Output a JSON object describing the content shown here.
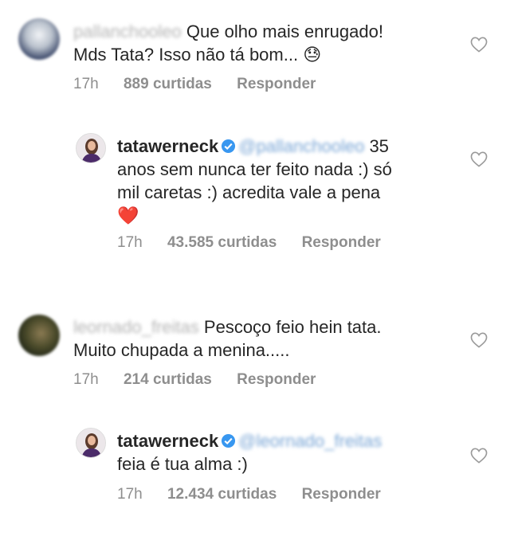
{
  "comments": [
    {
      "username": "pallanchooleo",
      "text": "Que olho mais enrugado! Mds Tata? Isso não tá bom...",
      "emoji": "😓",
      "time": "17h",
      "likes": "889 curtidas",
      "reply": "Responder",
      "replies": [
        {
          "username": "tatawerneck",
          "mention": "@pallanchooleo",
          "text_line1": "35",
          "text_line2": "anos sem nunca ter feito nada :) só",
          "text_line3": "mil caretas :) acredita vale a pena",
          "emoji": "❤️",
          "time": "17h",
          "likes": "43.585 curtidas",
          "reply": "Responder"
        }
      ]
    },
    {
      "username": "leornado_freitas",
      "text_line1": "Pescoço feio hein tata.",
      "text_line2": "Muito chupada a menina.....",
      "time": "17h",
      "likes": "214 curtidas",
      "reply": "Responder",
      "replies": [
        {
          "username": "tatawerneck",
          "mention": "@leornado_freitas",
          "text_line1": "feia é tua alma :)",
          "time": "17h",
          "likes": "12.434 curtidas",
          "reply": "Responder"
        }
      ]
    }
  ],
  "icons": {
    "like": "heart-outline-icon",
    "verified": "verified-badge-icon"
  },
  "colors": {
    "text": "#262626",
    "meta": "#8e8e8e",
    "verified": "#3897f0",
    "heart": "#e02020"
  }
}
